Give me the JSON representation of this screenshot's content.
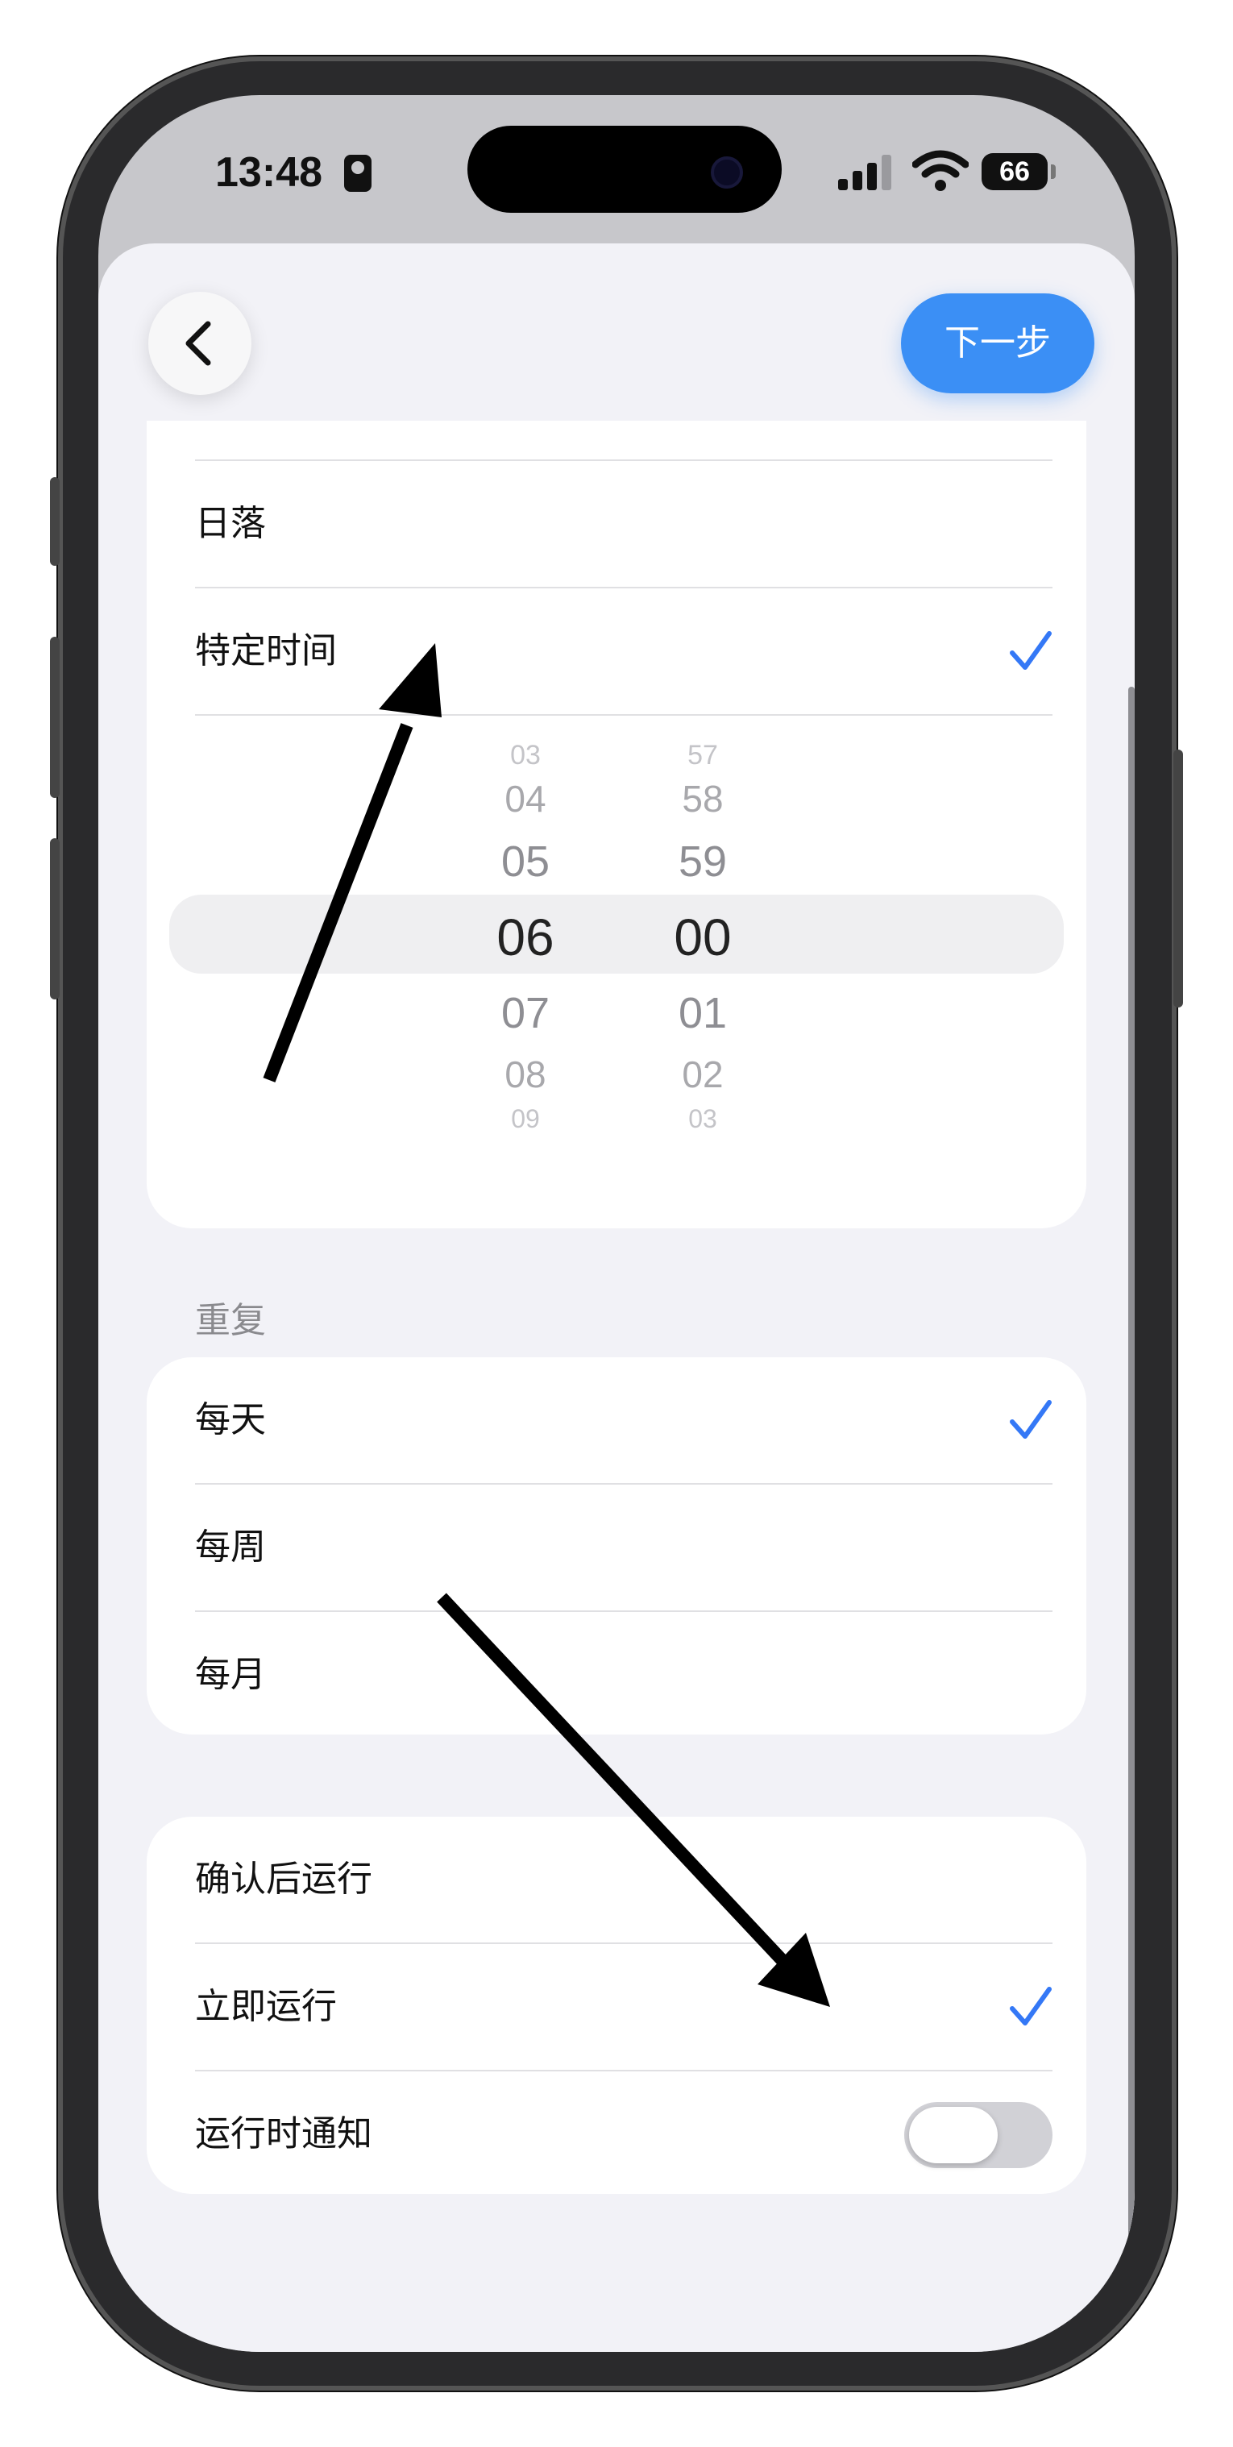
{
  "status_bar": {
    "time": "13:48",
    "battery": "66"
  },
  "header": {
    "back_icon": "chevron-left-icon",
    "next_label": "下一步"
  },
  "trigger_options": [
    {
      "label": "日落",
      "checked": false
    },
    {
      "label": "特定时间",
      "checked": true
    }
  ],
  "time_picker": {
    "hours": [
      "03",
      "04",
      "05",
      "06",
      "07",
      "08",
      "09"
    ],
    "minutes": [
      "57",
      "58",
      "59",
      "00",
      "01",
      "02",
      "03"
    ],
    "selected_hour": "06",
    "selected_minute": "00"
  },
  "repeat": {
    "title": "重复",
    "options": [
      {
        "label": "每天",
        "checked": true
      },
      {
        "label": "每周",
        "checked": false
      },
      {
        "label": "每月",
        "checked": false
      }
    ]
  },
  "run_options": [
    {
      "label": "确认后运行",
      "checked": false
    },
    {
      "label": "立即运行",
      "checked": true
    }
  ],
  "notify": {
    "label": "运行时通知",
    "enabled": false
  },
  "colors": {
    "accent": "#3b8ff5",
    "check": "#3478f6"
  }
}
